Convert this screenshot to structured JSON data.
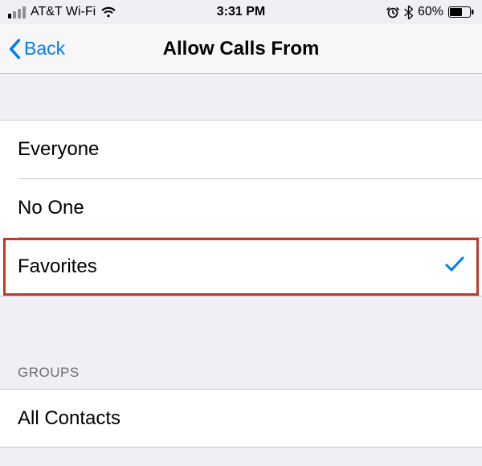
{
  "status": {
    "carrier": "AT&T Wi-Fi",
    "time": "3:31 PM",
    "battery_pct": "60%"
  },
  "nav": {
    "back_label": "Back",
    "title": "Allow Calls From"
  },
  "options": {
    "everyone": "Everyone",
    "no_one": "No One",
    "favorites": "Favorites"
  },
  "groups": {
    "header": "GROUPS",
    "all_contacts": "All Contacts"
  },
  "selected": "favorites",
  "colors": {
    "tint": "#007aff",
    "highlight": "#c0392b"
  }
}
